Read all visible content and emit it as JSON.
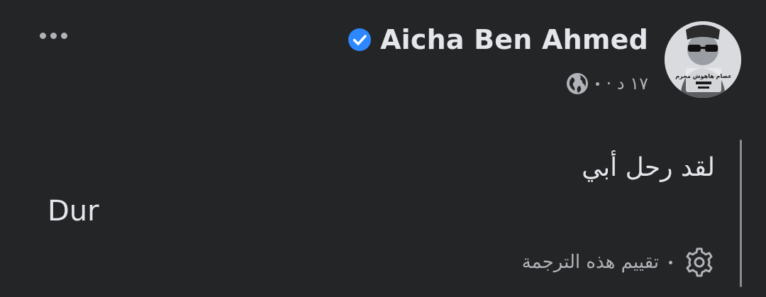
{
  "post": {
    "author_name": "Aicha Ben Ahmed",
    "verified": true,
    "timestamp": "١٧ د ·",
    "privacy_icon": "globe-icon",
    "original_text": "لقد رحل أبي",
    "translated_text": "Dur",
    "rate_translation_label": "تقييم هذه الترجمة",
    "rate_icon": "gear-icon",
    "more_icon": "more-horizontal-icon"
  },
  "avatar": {
    "caption_text": "عصام هاهوش مجرم"
  },
  "colors": {
    "background": "#242526",
    "primary_text": "#e4e6eb",
    "secondary_text": "#b0b3b8",
    "verified_badge": "#2d88ff",
    "quote_bar": "#8a8d91"
  }
}
